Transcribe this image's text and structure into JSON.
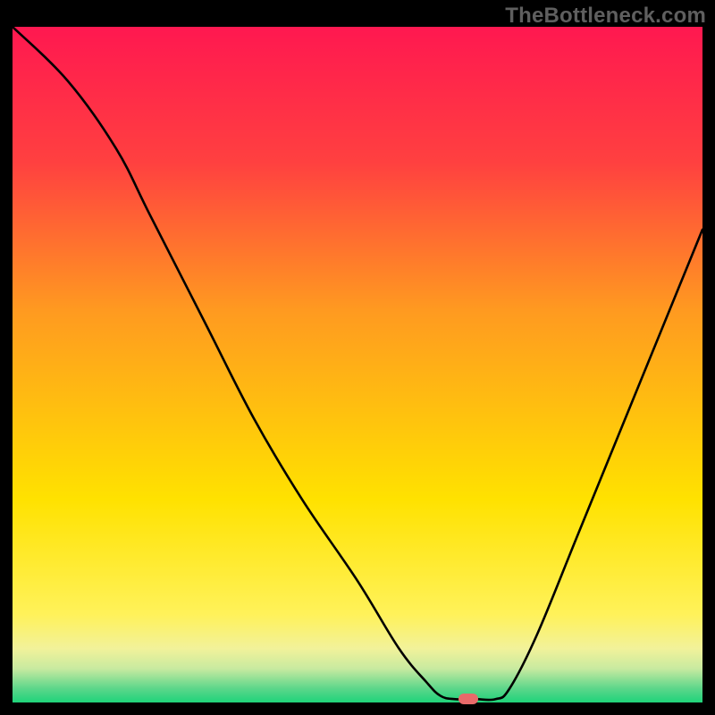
{
  "watermark": "TheBottleneck.com",
  "chart_data": {
    "type": "line",
    "title": "",
    "xlabel": "",
    "ylabel": "",
    "xlim": [
      0,
      100
    ],
    "ylim": [
      0,
      100
    ],
    "grid": false,
    "gradient": {
      "top_color": "#ff1850",
      "mid1_color": "#ff7a20",
      "mid2_color": "#ffe200",
      "band_color": "#eeee85",
      "bottom_color": "#1fd37a"
    },
    "series": [
      {
        "name": "curve",
        "color": "#000000",
        "x": [
          0,
          8,
          15,
          20,
          28,
          35,
          42,
          50,
          56,
          60,
          62,
          64,
          67,
          70,
          72,
          76,
          82,
          90,
          100
        ],
        "y": [
          100,
          92,
          82,
          72,
          56,
          42,
          30,
          18,
          8,
          3,
          1,
          0.5,
          0.5,
          0.5,
          2,
          10,
          25,
          45,
          70
        ]
      }
    ],
    "marker": {
      "name": "optimum-point",
      "x": 66,
      "y": 0.5,
      "color": "#e86a6a"
    }
  }
}
